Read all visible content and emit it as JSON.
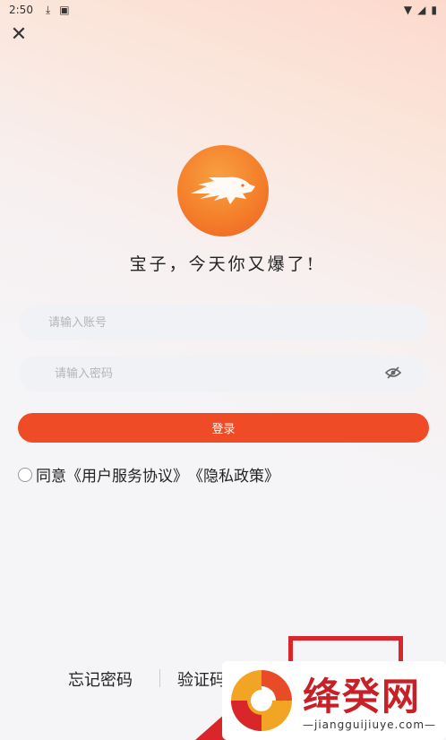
{
  "status_bar": {
    "time": "2:50",
    "download_icon": "download-icon",
    "notification_icon": "a-badge-icon"
  },
  "close_icon": "close-icon",
  "logo_icon": "wolf-logo-icon",
  "slogan": "宝子，今天你又爆了!",
  "account_input": {
    "placeholder": "请输入账号",
    "value": ""
  },
  "password_input": {
    "placeholder": "请输入密码",
    "value": ""
  },
  "eye_icon": "eye-off-icon",
  "login_button": "登录",
  "agreement": {
    "prefix": "同意",
    "user_agreement": "《用户服务协议》",
    "privacy_policy": "《隐私政策》"
  },
  "bottom_links": {
    "forgot_password": "忘记密码",
    "code_login": "验证码登录"
  },
  "watermark": {
    "title": "绛癸网",
    "url": "—jiangguijiuye.com—"
  },
  "colors": {
    "accent": "#ee4b26",
    "highlight": "#d9262b",
    "logo": "#f47f2b"
  }
}
